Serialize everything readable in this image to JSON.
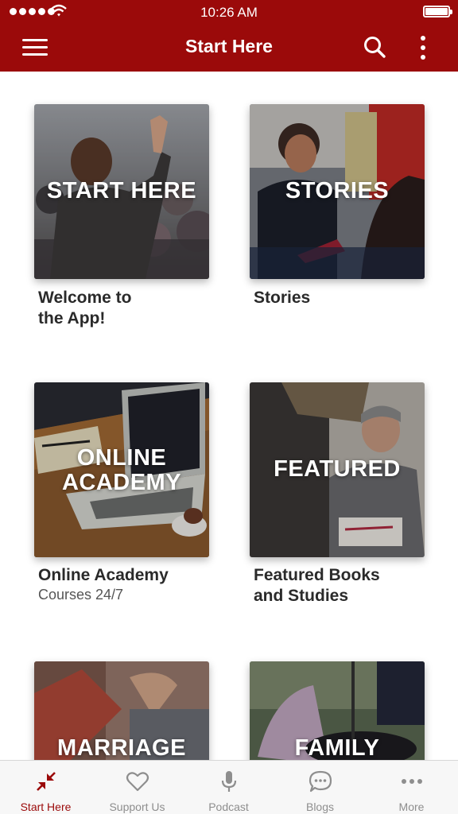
{
  "status_bar": {
    "time": "10:26 AM",
    "icons": [
      "signal-dots-icon",
      "wifi-icon",
      "battery-icon"
    ]
  },
  "nav_bar": {
    "title": "Start Here",
    "icons": [
      "hamburger-menu-icon",
      "search-icon",
      "more-vertical-icon"
    ]
  },
  "tiles": [
    {
      "label": "START HERE",
      "caption_lines": [
        "Welcome to",
        "the App!"
      ],
      "subcaption": ""
    },
    {
      "label": "STORIES",
      "caption_lines": [
        "Stories"
      ],
      "subcaption": ""
    },
    {
      "label_lines": [
        "ONLINE",
        "ACADEMY"
      ],
      "caption_lines": [
        "Online Academy"
      ],
      "subcaption": "Courses 24/7"
    },
    {
      "label": "FEATURED",
      "caption_lines": [
        "Featured Books",
        "and Studies"
      ],
      "subcaption": ""
    },
    {
      "label": "MARRIAGE"
    },
    {
      "label": "FAMILY"
    }
  ],
  "tab_bar": {
    "active": "Start Here",
    "tabs": [
      {
        "label": "Start Here",
        "icon": "arrows-in-icon"
      },
      {
        "label": "Support Us",
        "icon": "heart-icon"
      },
      {
        "label": "Podcast",
        "icon": "microphone-icon"
      },
      {
        "label": "Blogs",
        "icon": "chat-bubble-icon"
      },
      {
        "label": "More",
        "icon": "more-horizontal-icon"
      }
    ]
  },
  "colors": {
    "brand_red": "#9b0a0a",
    "tab_inactive": "#8e8e8e",
    "text_dark": "#2a2a2a"
  }
}
